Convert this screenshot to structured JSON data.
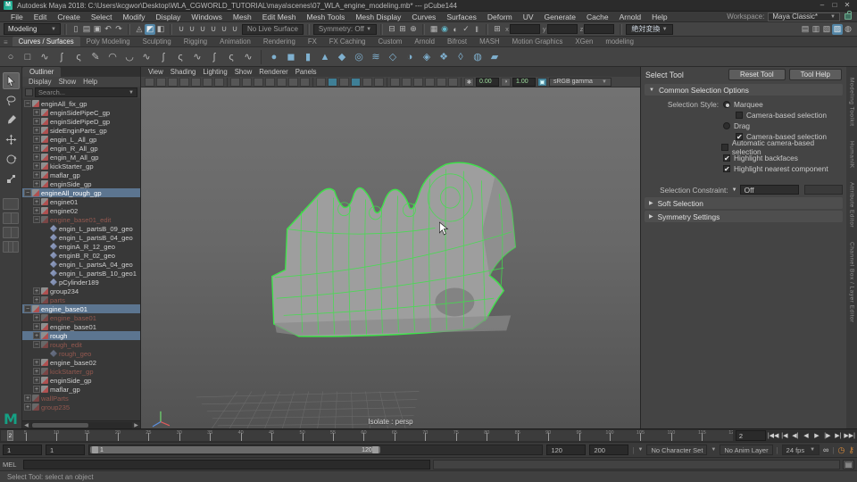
{
  "titlebar": {
    "title": "Autodesk Maya 2018: C:\\Users\\kcgwor\\Desktop\\WLA_CGWORLD_TUTORIAL\\maya\\scenes\\07_WLA_engine_modeling.mb* --- pCube144",
    "window_controls": [
      "–",
      "□",
      "✕"
    ]
  },
  "menubar": {
    "items": [
      "File",
      "Edit",
      "Create",
      "Select",
      "Modify",
      "Display",
      "Windows",
      "Mesh",
      "Edit Mesh",
      "Mesh Tools",
      "Mesh Display",
      "Curves",
      "Surfaces",
      "Deform",
      "UV",
      "Generate",
      "Cache",
      "Arnold",
      "Help"
    ],
    "workspace_label": "Workspace:",
    "workspace_value": "Maya Classic*"
  },
  "statusline": {
    "menuset": "Modeling",
    "file_icons": [
      {
        "name": "new-scene-icon",
        "g": "▯"
      },
      {
        "name": "open-scene-icon",
        "g": "▤"
      },
      {
        "name": "save-scene-icon",
        "g": "▣"
      },
      {
        "name": "undo-icon",
        "g": "↶"
      },
      {
        "name": "redo-icon",
        "g": "↷"
      }
    ],
    "selection_icons": [
      {
        "name": "select-hierarchy-icon",
        "g": "◬"
      },
      {
        "name": "select-object-icon",
        "g": "◩",
        "active": true
      },
      {
        "name": "select-component-icon",
        "g": "◧"
      }
    ],
    "snap_icons": [
      {
        "name": "snap-grid-icon",
        "g": "∪"
      },
      {
        "name": "snap-curve-icon",
        "g": "∪"
      },
      {
        "name": "snap-point-icon",
        "g": "∪"
      },
      {
        "name": "snap-projected-center-icon",
        "g": "∪"
      },
      {
        "name": "snap-view-plane-icon",
        "g": "∪"
      },
      {
        "name": "make-live-icon",
        "g": "∪"
      }
    ],
    "live_surface": "No Live Surface",
    "symmetry": "Symmetry: Off",
    "history_icons": [
      {
        "name": "input-operations-icon",
        "g": "⊟"
      },
      {
        "name": "output-operations-icon",
        "g": "⊞"
      },
      {
        "name": "construction-history-icon",
        "g": "⊕"
      }
    ],
    "render_icons": [
      {
        "name": "render-view-icon",
        "g": "▦"
      },
      {
        "name": "render-current-frame-icon",
        "g": "◉",
        "teal": true
      },
      {
        "name": "ipr-render-icon",
        "g": "◐"
      },
      {
        "name": "render-settings-icon",
        "g": "✓"
      },
      {
        "name": "pause-viewport-icon",
        "g": "‖"
      }
    ],
    "coord_icon": "⊞",
    "coord_labels": [
      "x",
      "y",
      "z"
    ],
    "transform_mode": "絶対変換",
    "sidebar_icons": [
      {
        "name": "raise-panels-icon",
        "g": "▤"
      },
      {
        "name": "attribute-editor-icon",
        "g": "▥"
      },
      {
        "name": "tool-settings-icon",
        "g": "▧"
      },
      {
        "name": "channel-box-icon",
        "g": "▨",
        "active": true
      },
      {
        "name": "modeling-toolkit-icon",
        "g": "◍"
      }
    ]
  },
  "shelf": {
    "tabs": [
      {
        "label": "Curves / Surfaces",
        "active": true
      },
      {
        "label": "Poly Modeling"
      },
      {
        "label": "Sculpting"
      },
      {
        "label": "Rigging"
      },
      {
        "label": "Animation"
      },
      {
        "label": "Rendering"
      },
      {
        "label": "FX"
      },
      {
        "label": "FX Caching"
      },
      {
        "label": "Custom"
      },
      {
        "label": "Arnold"
      },
      {
        "label": "Bifrost"
      },
      {
        "label": "MASH"
      },
      {
        "label": "Motion Graphics"
      },
      {
        "label": "XGen"
      },
      {
        "label": "modeling"
      }
    ],
    "icons": [
      {
        "name": "nurbs-circle-icon",
        "g": "○",
        "c": "#b9b9b9"
      },
      {
        "name": "nurbs-square-icon",
        "g": "□",
        "c": "#b9b9b9"
      },
      {
        "name": "cv-curve-tool-icon",
        "g": "∿",
        "c": "#b9b9b9"
      },
      {
        "name": "ep-curve-tool-icon",
        "g": "ʃ",
        "c": "#b9b9b9"
      },
      {
        "name": "bezier-curve-tool-icon",
        "g": "ς",
        "c": "#b9b9b9"
      },
      {
        "name": "pencil-curve-tool-icon",
        "g": "✎",
        "c": "#b9b9b9"
      },
      {
        "name": "three-point-arc-icon",
        "g": "◠",
        "c": "#b9b9b9"
      },
      {
        "name": "two-point-arc-icon",
        "g": "◡",
        "c": "#b9b9b9"
      },
      {
        "name": "attach-curves-icon",
        "g": "∿",
        "c": "#b9b9b9"
      },
      {
        "name": "detach-curves-icon",
        "g": "ʃ",
        "c": "#b9b9b9"
      },
      {
        "name": "insert-knot-icon",
        "g": "ς",
        "c": "#b9b9b9"
      },
      {
        "name": "extend-curve-icon",
        "g": "∿",
        "c": "#b9b9b9"
      },
      {
        "name": "offset-curve-icon",
        "g": "ʃ",
        "c": "#b9b9b9"
      },
      {
        "name": "rebuild-curve-icon",
        "g": "ς",
        "c": "#b9b9b9"
      },
      {
        "name": "add-points-tool-icon",
        "g": "∿",
        "c": "#b9b9b9"
      },
      {
        "name": "shelf-separator",
        "sep": true
      },
      {
        "name": "nurbs-sphere-icon",
        "g": "●",
        "c": "#7fb0cf"
      },
      {
        "name": "nurbs-cube-icon",
        "g": "◼",
        "c": "#7fb0cf"
      },
      {
        "name": "nurbs-cylinder-icon",
        "g": "▮",
        "c": "#7fb0cf"
      },
      {
        "name": "nurbs-cone-icon",
        "g": "▲",
        "c": "#7fb0cf"
      },
      {
        "name": "nurbs-plane-icon",
        "g": "◆",
        "c": "#7fb0cf"
      },
      {
        "name": "nurbs-torus-icon",
        "g": "◎",
        "c": "#7fb0cf"
      },
      {
        "name": "loft-icon",
        "g": "≋",
        "c": "#7fb0cf"
      },
      {
        "name": "planar-icon",
        "g": "◇",
        "c": "#7fb0cf"
      },
      {
        "name": "revolve-icon",
        "g": "◑",
        "c": "#7fb0cf"
      },
      {
        "name": "birail-icon",
        "g": "◈",
        "c": "#7fb0cf"
      },
      {
        "name": "extrude-icon",
        "g": "❖",
        "c": "#7fb0cf"
      },
      {
        "name": "boundary-icon",
        "g": "◊",
        "c": "#7fb0cf"
      },
      {
        "name": "bevel-icon",
        "g": "◍",
        "c": "#7fb0cf"
      },
      {
        "name": "bevel-plus-icon",
        "g": "▰",
        "c": "#7fb0cf"
      }
    ]
  },
  "toolbox": {
    "tools": [
      {
        "name": "select-tool",
        "active": true
      },
      {
        "name": "lasso-tool"
      },
      {
        "name": "paint-selection-tool"
      },
      {
        "name": "move-tool"
      },
      {
        "name": "rotate-tool"
      },
      {
        "name": "scale-tool"
      }
    ],
    "layouts": [
      {
        "name": "layout-single-pane",
        "panes": 1
      },
      {
        "name": "layout-four-pane",
        "panes": 2
      },
      {
        "name": "layout-persp-outliner",
        "panes": 2
      },
      {
        "name": "layout-hypershade-persp",
        "panes": 3
      }
    ]
  },
  "outliner": {
    "tab": "Outliner",
    "menus": [
      "Display",
      "Show",
      "Help"
    ],
    "search_placeholder": "Search...",
    "items": [
      {
        "depth": 1,
        "expand": "open",
        "icon": "transform",
        "label": "enginAll_fix_gp"
      },
      {
        "depth": 2,
        "expand": "closed",
        "icon": "transform",
        "label": "enginSidePipeC_gp"
      },
      {
        "depth": 2,
        "expand": "closed",
        "icon": "transform",
        "label": "enginSidePipeD_gp"
      },
      {
        "depth": 2,
        "expand": "closed",
        "icon": "transform",
        "label": "sideEnginParts_gp"
      },
      {
        "depth": 2,
        "expand": "closed",
        "icon": "transform",
        "label": "engin_L_All_gp"
      },
      {
        "depth": 2,
        "expand": "closed",
        "icon": "transform",
        "label": "engin_R_All_gp"
      },
      {
        "depth": 2,
        "expand": "closed",
        "icon": "transform",
        "label": "engin_M_All_gp"
      },
      {
        "depth": 2,
        "expand": "closed",
        "icon": "transform",
        "label": "kickStarter_gp"
      },
      {
        "depth": 2,
        "expand": "closed",
        "icon": "transform",
        "label": "maflar_gp"
      },
      {
        "depth": 2,
        "expand": "closed",
        "icon": "transform",
        "label": "enginSide_gp"
      },
      {
        "depth": 1,
        "expand": "open",
        "icon": "transform",
        "label": "engineAll_rough_gp",
        "state": "selected"
      },
      {
        "depth": 2,
        "expand": "closed",
        "icon": "transform",
        "label": "engine01"
      },
      {
        "depth": 2,
        "expand": "closed",
        "icon": "transform",
        "label": "engine02"
      },
      {
        "depth": 2,
        "expand": "open",
        "icon": "transform",
        "label": "engine_base01_edit",
        "state": "dim"
      },
      {
        "depth": 3,
        "expand": "leaf",
        "icon": "mesh",
        "label": "engin_L_partsB_09_geo"
      },
      {
        "depth": 3,
        "expand": "leaf",
        "icon": "mesh",
        "label": "engin_L_partsB_04_geo"
      },
      {
        "depth": 3,
        "expand": "leaf",
        "icon": "mesh",
        "label": "enginA_R_12_geo"
      },
      {
        "depth": 3,
        "expand": "leaf",
        "icon": "mesh",
        "label": "enginB_R_02_geo"
      },
      {
        "depth": 3,
        "expand": "leaf",
        "icon": "mesh",
        "label": "engin_L_partsA_04_geo"
      },
      {
        "depth": 3,
        "expand": "leaf",
        "icon": "mesh",
        "label": "engin_L_partsB_10_geo1"
      },
      {
        "depth": 3,
        "expand": "leaf",
        "icon": "mesh",
        "label": "pCylinder189"
      },
      {
        "depth": 2,
        "expand": "closed",
        "icon": "transform",
        "label": "group234"
      },
      {
        "depth": 2,
        "expand": "closed",
        "icon": "transform",
        "label": "parts",
        "state": "dim"
      },
      {
        "depth": 1,
        "expand": "open",
        "icon": "transform",
        "label": "engine_base01",
        "state": "selected"
      },
      {
        "depth": 2,
        "expand": "closed",
        "icon": "transform",
        "label": "engine_base01",
        "state": "dim"
      },
      {
        "depth": 2,
        "expand": "closed",
        "icon": "transform",
        "label": "engine_base01"
      },
      {
        "depth": 2,
        "expand": "closed",
        "icon": "transform",
        "label": "rough",
        "state": "selected"
      },
      {
        "depth": 2,
        "expand": "open",
        "icon": "transform",
        "label": "rough_edit",
        "state": "dim"
      },
      {
        "depth": 3,
        "expand": "leaf",
        "icon": "mesh",
        "label": "rough_geo",
        "state": "dim"
      },
      {
        "depth": 2,
        "expand": "closed",
        "icon": "transform",
        "label": "engine_base02"
      },
      {
        "depth": 2,
        "expand": "closed",
        "icon": "transform",
        "label": "kickStarter_gp",
        "state": "dim"
      },
      {
        "depth": 2,
        "expand": "closed",
        "icon": "transform",
        "label": "enginSide_gp"
      },
      {
        "depth": 2,
        "expand": "closed",
        "icon": "transform",
        "label": "maflar_gp"
      },
      {
        "depth": 1,
        "expand": "closed",
        "icon": "transform",
        "label": "wallParts",
        "state": "dim"
      },
      {
        "depth": 1,
        "expand": "closed",
        "icon": "transform",
        "label": "group235",
        "state": "dim"
      }
    ]
  },
  "viewport": {
    "menus": [
      "View",
      "Shading",
      "Lighting",
      "Show",
      "Renderer",
      "Panels"
    ],
    "toolbar_icons": [
      {
        "name": "select-camera-icon"
      },
      {
        "name": "lock-camera-icon"
      },
      {
        "name": "camera-attributes-icon"
      },
      {
        "name": "bookmarks-icon"
      },
      {
        "name": "image-plane-icon"
      },
      {
        "name": "2d-pan-zoom-icon"
      },
      {
        "name": "oversc-icon"
      },
      {
        "name": "grid-display-icon"
      },
      {
        "name": "film-gate-icon"
      },
      {
        "name": "resolution-gate-icon"
      },
      {
        "name": "gate-mask-icon"
      },
      {
        "name": "field-chart-icon"
      },
      {
        "name": "safe-action-icon"
      },
      {
        "name": "safe-title-icon"
      },
      {
        "name": "wireframe-mode-icon"
      },
      {
        "name": "shaded-mode-icon",
        "teal": true
      },
      {
        "name": "textured-mode-icon"
      },
      {
        "name": "use-all-lights-icon",
        "teal": true
      },
      {
        "name": "shadows-icon"
      },
      {
        "name": "ambient-occlusion-icon"
      },
      {
        "name": "motion-blur-icon"
      },
      {
        "name": "multisample-aa-icon"
      },
      {
        "name": "isolate-select-icon"
      },
      {
        "name": "xray-icon"
      },
      {
        "name": "xray-joints-icon"
      },
      {
        "name": "exposure-icon"
      }
    ],
    "gear_icon": "✱",
    "exposure_value": "0.00",
    "gamma_value": "1.00",
    "color_mgmt_value": "sRGB gamma",
    "camera_label": "Isolate : persp"
  },
  "tool_settings": {
    "title": "Select Tool",
    "reset_button": "Reset Tool",
    "help_button": "Tool Help",
    "frame1_label": "Common Selection Options",
    "selection_style_label": "Selection Style:",
    "options": [
      {
        "type": "radio",
        "label": "Marquee",
        "checked": true,
        "indent": 0,
        "lead": "Selection Style:"
      },
      {
        "type": "checkbox",
        "label": "Camera-based selection",
        "checked": false,
        "indent": 1
      },
      {
        "type": "radio",
        "label": "Drag",
        "checked": false,
        "indent": 0
      },
      {
        "type": "checkbox",
        "label": "Camera-based selection",
        "checked": true,
        "indent": 1
      },
      {
        "type": "checkbox",
        "label": "Automatic camera-based selection",
        "checked": false,
        "indent": 0
      },
      {
        "type": "checkbox",
        "label": "Highlight backfaces",
        "checked": true,
        "indent": 0
      },
      {
        "type": "checkbox",
        "label": "Highlight nearest component",
        "checked": true,
        "indent": 0
      }
    ],
    "constraint_label": "Selection Constraint:",
    "constraint_value": "Off",
    "frame2_label": "Soft Selection",
    "frame3_label": "Symmetry Settings"
  },
  "sidebar_tabs": [
    "Modeling Toolkit",
    "HumanIK",
    "Attribute Editor",
    "Channel Box / Layer Editor"
  ],
  "timeline": {
    "start": 1,
    "end": 120,
    "label_step": 5,
    "current": 2,
    "current_time_field": "2"
  },
  "playback": [
    {
      "name": "go-to-start-button",
      "g": "|◀◀"
    },
    {
      "name": "prev-key-button",
      "g": "|◀"
    },
    {
      "name": "prev-frame-button",
      "g": "◀|"
    },
    {
      "name": "play-backwards-button",
      "g": "◀"
    },
    {
      "name": "play-forwards-button",
      "g": "▶"
    },
    {
      "name": "next-frame-button",
      "g": "|▶"
    },
    {
      "name": "next-key-button",
      "g": "▶|"
    },
    {
      "name": "go-to-end-button",
      "g": "▶▶|"
    }
  ],
  "range": {
    "anim_start": "1",
    "playback_start": "1",
    "bar_start_label": "1",
    "bar_end_label": "120",
    "playback_end": "120",
    "anim_end": "200",
    "character_set": "No Character Set",
    "anim_layer": "No Anim Layer",
    "fps": "24 fps",
    "loop_icon": "∞",
    "anim_prefs_icon": "◷",
    "auto_key_icon": "⚷"
  },
  "command_line": {
    "label": "MEL"
  },
  "help_line": {
    "text": "Select Tool: select an object"
  }
}
